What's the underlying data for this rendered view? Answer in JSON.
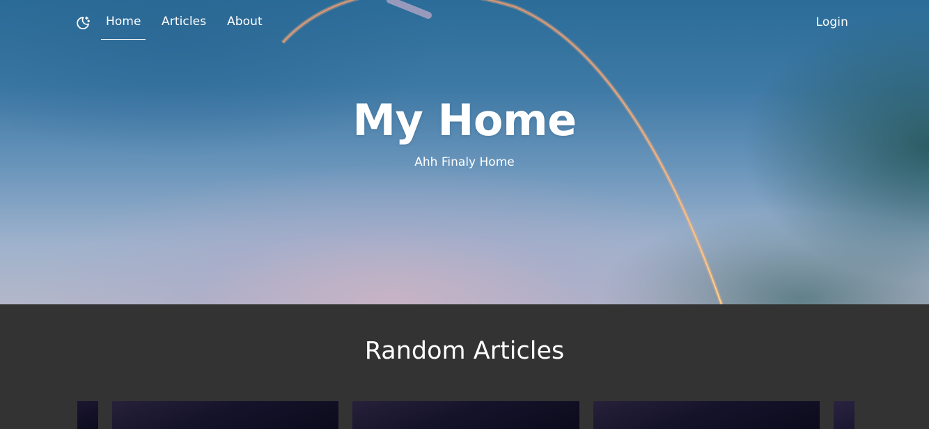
{
  "nav": {
    "theme_toggle_icon": "moon-stars-icon",
    "links": [
      {
        "label": "Home",
        "active": true
      },
      {
        "label": "Articles",
        "active": false
      },
      {
        "label": "About",
        "active": false
      }
    ],
    "login_label": "Login"
  },
  "hero": {
    "title": "My Home",
    "subtitle": "Ahh Finaly Home"
  },
  "random_articles": {
    "heading": "Random Articles"
  },
  "colors": {
    "page_background": "#333333",
    "text": "#ffffff",
    "streak": "#ffb070",
    "card_background": "#15132a"
  }
}
